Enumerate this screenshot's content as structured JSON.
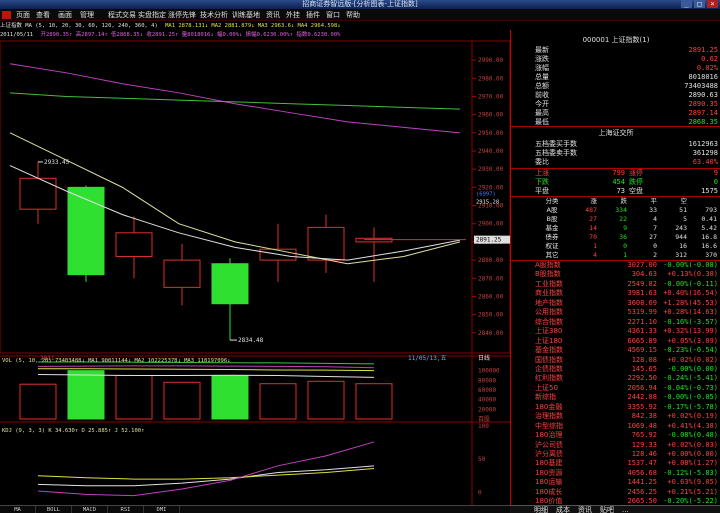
{
  "window": {
    "title": "招商证券智远版-[分析图表-上证指数]"
  },
  "menu": [
    "页面",
    "查看",
    "画面",
    "管理",
    "程式交易",
    "实盘指定",
    "涨停先锋",
    "技术分析",
    "训练基地",
    "资讯",
    "外挂",
    "插件",
    "窗口",
    "帮助"
  ],
  "chart_header": {
    "indicator": "上证指数 MA (5, 10, 20, 30, 60, 120, 240, 360, 4)",
    "ma_values": "MA1 2878.131↓ MA2 2881.879↓ MA3 2963.6↓ MA4 2964.598↓",
    "date": "2011/05/11",
    "ohlc": "开2890.35↑ 高2897.14↑ 低2868.35↓ 收2891.25↑ 量8018016↓ 幅0.00%↓ 振幅0.6230.00%↑ 指数0.6230.00%"
  },
  "price_axis": [
    "2990.00",
    "2980.00",
    "2970.00",
    "2960.00",
    "2950.00",
    "2940.00",
    "2930.00",
    "2920.00",
    "2910.00",
    "2900.00",
    "2890.00",
    "2880.00",
    "2870.00",
    "2860.00",
    "2850.00",
    "2840.00"
  ],
  "axis_markers": {
    "left_badge": "(6997)",
    "price_badge": "2915.28",
    "cursor_price": "2891.25"
  },
  "annotations": {
    "high": "2933.45",
    "low": "2834.48",
    "year": "2011",
    "cursor_date": "11/05/13,五",
    "date_label": "日线"
  },
  "volume_header": "VOL (5, 10, 20)  73403488↓  MA1 90011144↓  MA2 102225378↓  MA3 118197096↓",
  "volume_axis": [
    "100000",
    "80000",
    "60000",
    "40000",
    "20000"
  ],
  "volume_unit": "百股",
  "kdj_header": "KDJ (9, 3, 3)  K 34.630↑  D 25.885↑  J 52.100↑",
  "kdj_axis": [
    "100",
    "50",
    "0"
  ],
  "bottom_tabs": [
    "MA",
    "BOLL",
    "MACD",
    "RSI",
    "DMI"
  ],
  "quote_panel": {
    "title": "000001 上证指数(1)",
    "rows": [
      {
        "label": "最新",
        "value": "2891.25",
        "color": "red"
      },
      {
        "label": "涨跌",
        "value": "0.62",
        "color": "red"
      },
      {
        "label": "涨幅",
        "value": "0.02%",
        "color": "red"
      },
      {
        "label": "总量",
        "value": "8018016",
        "color": "wht"
      },
      {
        "label": "总额",
        "value": "73403488",
        "color": "wht"
      },
      {
        "label": "前收",
        "value": "2890.63",
        "color": "wht"
      },
      {
        "label": "今开",
        "value": "2890.35",
        "color": "red"
      },
      {
        "label": "最高",
        "value": "2897.14",
        "color": "red"
      },
      {
        "label": "最低",
        "value": "2868.35",
        "color": "grn"
      }
    ],
    "exchange": "上海证交所",
    "orders": [
      {
        "label": "五档委买手数",
        "value": "1612963",
        "color": "wht"
      },
      {
        "label": "五档委卖手数",
        "value": "361298",
        "color": "wht"
      },
      {
        "label": "委比",
        "value": "63.40%",
        "color": "red"
      }
    ],
    "breadth": [
      {
        "label": "上涨",
        "value": "799",
        "label2": "涨停",
        "value2": "9",
        "c1": "red",
        "c2": "red"
      },
      {
        "label": "下跌",
        "value": "454",
        "label2": "跌停",
        "value2": "0",
        "c1": "grn",
        "c2": "grn"
      },
      {
        "label": "平盘",
        "value": "73",
        "label2": "空盘",
        "value2": "1575",
        "c1": "wht",
        "c2": "wht"
      }
    ],
    "class_table": {
      "headers": [
        "分类",
        "涨",
        "跌",
        "平",
        "空",
        "",
        ""
      ],
      "rows": [
        [
          "A股",
          "487",
          "334",
          "33",
          "51",
          "793"
        ],
        [
          "B股",
          "27",
          "22",
          "4",
          "5",
          "0.41"
        ],
        [
          "基金",
          "14",
          "9",
          "7",
          "243",
          "5.42"
        ],
        [
          "债券",
          "70",
          "36",
          "27",
          "944",
          "16.8"
        ],
        [
          "权证",
          "1",
          "0",
          "0",
          "16",
          "16.6"
        ],
        [
          "其它",
          "4",
          "1",
          "2",
          "312",
          "370"
        ]
      ]
    },
    "indices": [
      {
        "name": "A股指数",
        "price": "3027.00",
        "change": "-0.00%(-0.08)",
        "color": "grn"
      },
      {
        "name": "B股指数",
        "price": "304.63",
        "change": "+0.13%(0.38)",
        "color": "red"
      },
      {
        "name": "工业指数",
        "price": "2549.82",
        "change": "-0.00%(-0.11)",
        "color": "grn"
      },
      {
        "name": "商业指数",
        "price": "3981.63",
        "change": "+0.40%(16.54)",
        "color": "red"
      },
      {
        "name": "地产指数",
        "price": "3608.69",
        "change": "+1.28%(45.53)",
        "color": "red"
      },
      {
        "name": "公用指数",
        "price": "5319.99",
        "change": "+0.28%(14.63)",
        "color": "red"
      },
      {
        "name": "综合指数",
        "price": "2271.10",
        "change": "-0.16%(-3.57)",
        "color": "grn"
      },
      {
        "name": "上证380",
        "price": "4361.33",
        "change": "+0.32%(13.99)",
        "color": "red"
      },
      {
        "name": "上证180",
        "price": "6665.89",
        "change": "+0.05%(3.09)",
        "color": "red"
      },
      {
        "name": "基金指数",
        "price": "4569.15",
        "change": "-0.23%(-0.54)",
        "color": "grn"
      },
      {
        "name": "国债指数",
        "price": "128.08",
        "change": "+0.02%(0.02)",
        "color": "red"
      },
      {
        "name": "企债指数",
        "price": "145.65",
        "change": "-0.00%(0.00)",
        "color": "grn"
      },
      {
        "name": "红利指数",
        "price": "2292.50",
        "change": "-0.24%(-5.41)",
        "color": "grn"
      },
      {
        "name": "上证50",
        "price": "2056.94",
        "change": "-0.04%(-0.73)",
        "color": "grn"
      },
      {
        "name": "新综指",
        "price": "2442.88",
        "change": "-0.00%(-0.05)",
        "color": "grn"
      },
      {
        "name": "180金融",
        "price": "3355.92",
        "change": "-0.17%(-5.78)",
        "color": "grn"
      },
      {
        "name": "治理指数",
        "price": "842.38",
        "change": "+0.02%(0.19)",
        "color": "red"
      },
      {
        "name": "中型综指",
        "price": "1069.48",
        "change": "+0.41%(4.38)",
        "color": "red"
      },
      {
        "name": "180治理",
        "price": "765.92",
        "change": "-0.08%(0.48)",
        "color": "grn"
      },
      {
        "name": "沪公司债",
        "price": "129.33",
        "change": "+0.02%(0.03)",
        "color": "red"
      },
      {
        "name": "沪分离债",
        "price": "128.46",
        "change": "+0.00%(0.00)",
        "color": "red"
      },
      {
        "name": "180基建",
        "price": "1537.47",
        "change": "+0.08%(1.27)",
        "color": "red"
      },
      {
        "name": "180资源",
        "price": "4056.68",
        "change": "-0.12%(-5.83)",
        "color": "grn"
      },
      {
        "name": "180运输",
        "price": "1441.25",
        "change": "+0.63%(9.05)",
        "color": "red"
      },
      {
        "name": "180成长",
        "price": "2456.25",
        "change": "+0.21%(5.21)",
        "color": "red"
      },
      {
        "name": "180价值",
        "price": "2665.50",
        "change": "-0.20%(-5.22)",
        "color": "grn"
      }
    ],
    "tabs": [
      "明细",
      "成本",
      "资讯",
      "贴吧",
      "..."
    ]
  },
  "chart_data": {
    "type": "candlestick",
    "price_range": [
      2830,
      2995
    ],
    "candles": [
      {
        "open": 2908,
        "close": 2925,
        "high": 2934,
        "low": 2900,
        "vol": 72000
      },
      {
        "open": 2920,
        "close": 2872,
        "high": 2921,
        "low": 2868,
        "vol": 100000
      },
      {
        "open": 2882,
        "close": 2895,
        "high": 2904,
        "low": 2870,
        "vol": 90000
      },
      {
        "open": 2865,
        "close": 2880,
        "high": 2889,
        "low": 2855,
        "vol": 76000
      },
      {
        "open": 2878,
        "close": 2856,
        "high": 2881,
        "low": 2836,
        "vol": 90000
      },
      {
        "open": 2880,
        "close": 2886,
        "high": 2900,
        "low": 2868,
        "vol": 73000
      },
      {
        "open": 2880,
        "close": 2898,
        "high": 2905,
        "low": 2873,
        "vol": 78000
      },
      {
        "open": 2890,
        "close": 2892,
        "high": 2898,
        "low": 2868,
        "vol": 73000
      }
    ],
    "ma_lines": [
      {
        "name": "MA1",
        "color": "#e0e0a0",
        "points": [
          2950,
          2935,
          2920,
          2900,
          2890,
          2884,
          2878,
          2882,
          2890
        ]
      },
      {
        "name": "MA2",
        "color": "#e0e0e0",
        "points": [
          2932,
          2918,
          2905,
          2895,
          2887,
          2882,
          2880,
          2885,
          2891
        ]
      },
      {
        "name": "MA3",
        "color": "#c040c0",
        "points": [
          2988,
          2983,
          2977,
          2972,
          2966,
          2961,
          2956,
          2953,
          2950
        ]
      },
      {
        "name": "MA4",
        "color": "#40c040",
        "points": [
          2972,
          2970,
          2969,
          2968,
          2967,
          2966,
          2965,
          2964,
          2963
        ]
      }
    ],
    "vol_ma": [
      {
        "color": "#e0e0e0",
        "points": [
          92000,
          91000,
          90000,
          90000,
          90500,
          90000,
          88000,
          86000
        ]
      },
      {
        "color": "#e0e040",
        "points": [
          104000,
          104000,
          103500,
          103000,
          102500,
          101500,
          101000,
          100000
        ]
      },
      {
        "color": "#c040c0",
        "points": [
          109000,
          109500,
          110000,
          110000,
          109500,
          109000,
          108000,
          106000
        ]
      },
      {
        "color": "#40c040",
        "points": [
          118000,
          118000,
          117500,
          117000,
          116500,
          116000,
          115000,
          114000
        ]
      }
    ],
    "kdj": [
      {
        "name": "K",
        "color": "#e0e0e0",
        "points": [
          12,
          10,
          10,
          14,
          20,
          30,
          34,
          40
        ]
      },
      {
        "name": "D",
        "color": "#e0e040",
        "points": [
          25,
          22,
          20,
          20,
          22,
          26,
          30,
          36
        ]
      },
      {
        "name": "J",
        "color": "#c040c0",
        "points": [
          2,
          -3,
          -5,
          5,
          18,
          40,
          55,
          76
        ]
      }
    ]
  }
}
